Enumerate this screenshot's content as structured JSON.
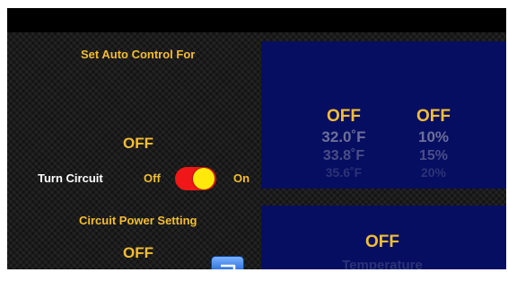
{
  "auto_control": {
    "title": "Set Auto Control For",
    "status": "OFF"
  },
  "turn_circuit": {
    "label": "Turn Circuit",
    "off_label": "Off",
    "on_label": "On",
    "state": "on"
  },
  "power_setting": {
    "title": "Circuit Power Setting",
    "status": "OFF"
  },
  "picker_top": {
    "left": [
      "OFF",
      "32.0˚F",
      "33.8˚F",
      "35.6˚F"
    ],
    "right": [
      "OFF",
      "10%",
      "15%",
      "20%"
    ]
  },
  "picker_bottom": {
    "selected": "OFF",
    "next": "Temperature"
  },
  "colors": {
    "accent": "#f4be32",
    "panel": "#060e62",
    "toggle_on": "#ef1717",
    "knob": "#ffe90a"
  },
  "icons": {
    "back": "return-arrow-icon"
  }
}
